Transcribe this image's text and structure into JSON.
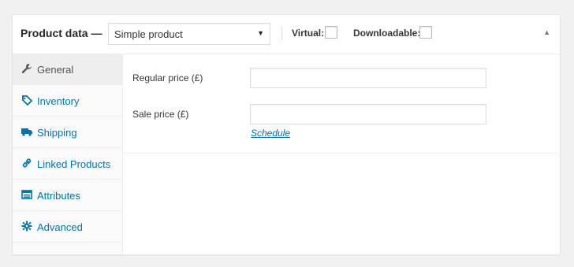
{
  "header": {
    "title": "Product data —",
    "product_type": {
      "selected": "Simple product",
      "options": [
        "Simple product"
      ]
    },
    "virtual_label": "Virtual:",
    "downloadable_label": "Downloadable:",
    "virtual_checked": false,
    "downloadable_checked": false,
    "toggle_icon": "collapse-arrow-up"
  },
  "tabs": [
    {
      "label": "General",
      "icon": "wrench-icon",
      "active": true
    },
    {
      "label": "Inventory",
      "icon": "tag-icon",
      "active": false
    },
    {
      "label": "Shipping",
      "icon": "truck-icon",
      "active": false
    },
    {
      "label": "Linked Products",
      "icon": "link-icon",
      "active": false
    },
    {
      "label": "Attributes",
      "icon": "list-icon",
      "active": false
    },
    {
      "label": "Advanced",
      "icon": "gear-icon",
      "active": false
    }
  ],
  "general": {
    "regular_price_label": "Regular price (£)",
    "regular_price_value": "",
    "sale_price_label": "Sale price (£)",
    "sale_price_value": "",
    "schedule_link": "Schedule"
  },
  "colors": {
    "link": "#0073aa",
    "active_tab_bg": "#eeeeee",
    "sidebar_bg": "#fafafa"
  }
}
